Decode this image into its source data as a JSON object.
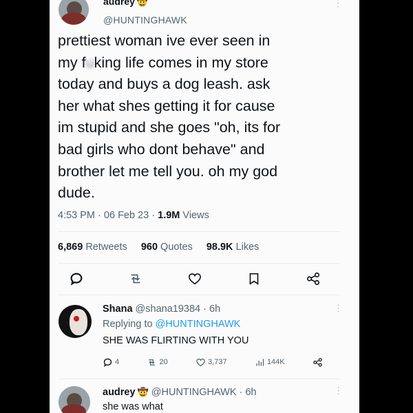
{
  "tweet": {
    "name": "audrey",
    "handle": "@HUNTINGHAWK",
    "lines": [
      "prettiest woman ive ever seen in",
      "today and buys a dog leash. ask",
      "her what shes getting it for cause",
      "im stupid and she goes \"oh, its for",
      "bad girls who dont behave\" and",
      "brother let me tell you. oh my god",
      "dude."
    ],
    "line2_pre": "my f",
    "line2_blur": "u",
    "line2_post": "king life comes in my store",
    "time": "4:53 PM",
    "date": "06 Feb 23",
    "views_count": "1.9M",
    "views_label": "Views",
    "sep": "·",
    "retweets_count": "6,869",
    "retweets_label": "Retweets",
    "quotes_count": "960",
    "quotes_label": "Quotes",
    "likes_count": "98.9K",
    "likes_label": "Likes"
  },
  "reply": {
    "name": "Shana",
    "handle": "@shana19384",
    "sep": "·",
    "age": "6h",
    "replying_label": "Replying to",
    "replying_handle": "@HUNTINGHAWK",
    "text": "SHE WAS FLIRTING WITH YOU",
    "reply_count": "4",
    "retweet_count": "20",
    "like_count": "3,737",
    "view_count": "144K"
  },
  "bottom_reply": {
    "name": "audrey",
    "handle": "@HUNTINGHAWK",
    "sep": "·",
    "age": "6h",
    "text": "she was what"
  },
  "icons": {
    "more": "more-icon",
    "verified": "cowboy-emoji-icon",
    "reply": "reply-icon",
    "retweet": "retweet-icon",
    "like": "heart-icon",
    "bookmark": "bookmark-icon",
    "share": "share-icon",
    "views": "views-icon"
  },
  "colors": {
    "text": "#0f1419",
    "secondary": "#536471",
    "link": "#1d9bf0",
    "background": "#fbfbfb"
  }
}
